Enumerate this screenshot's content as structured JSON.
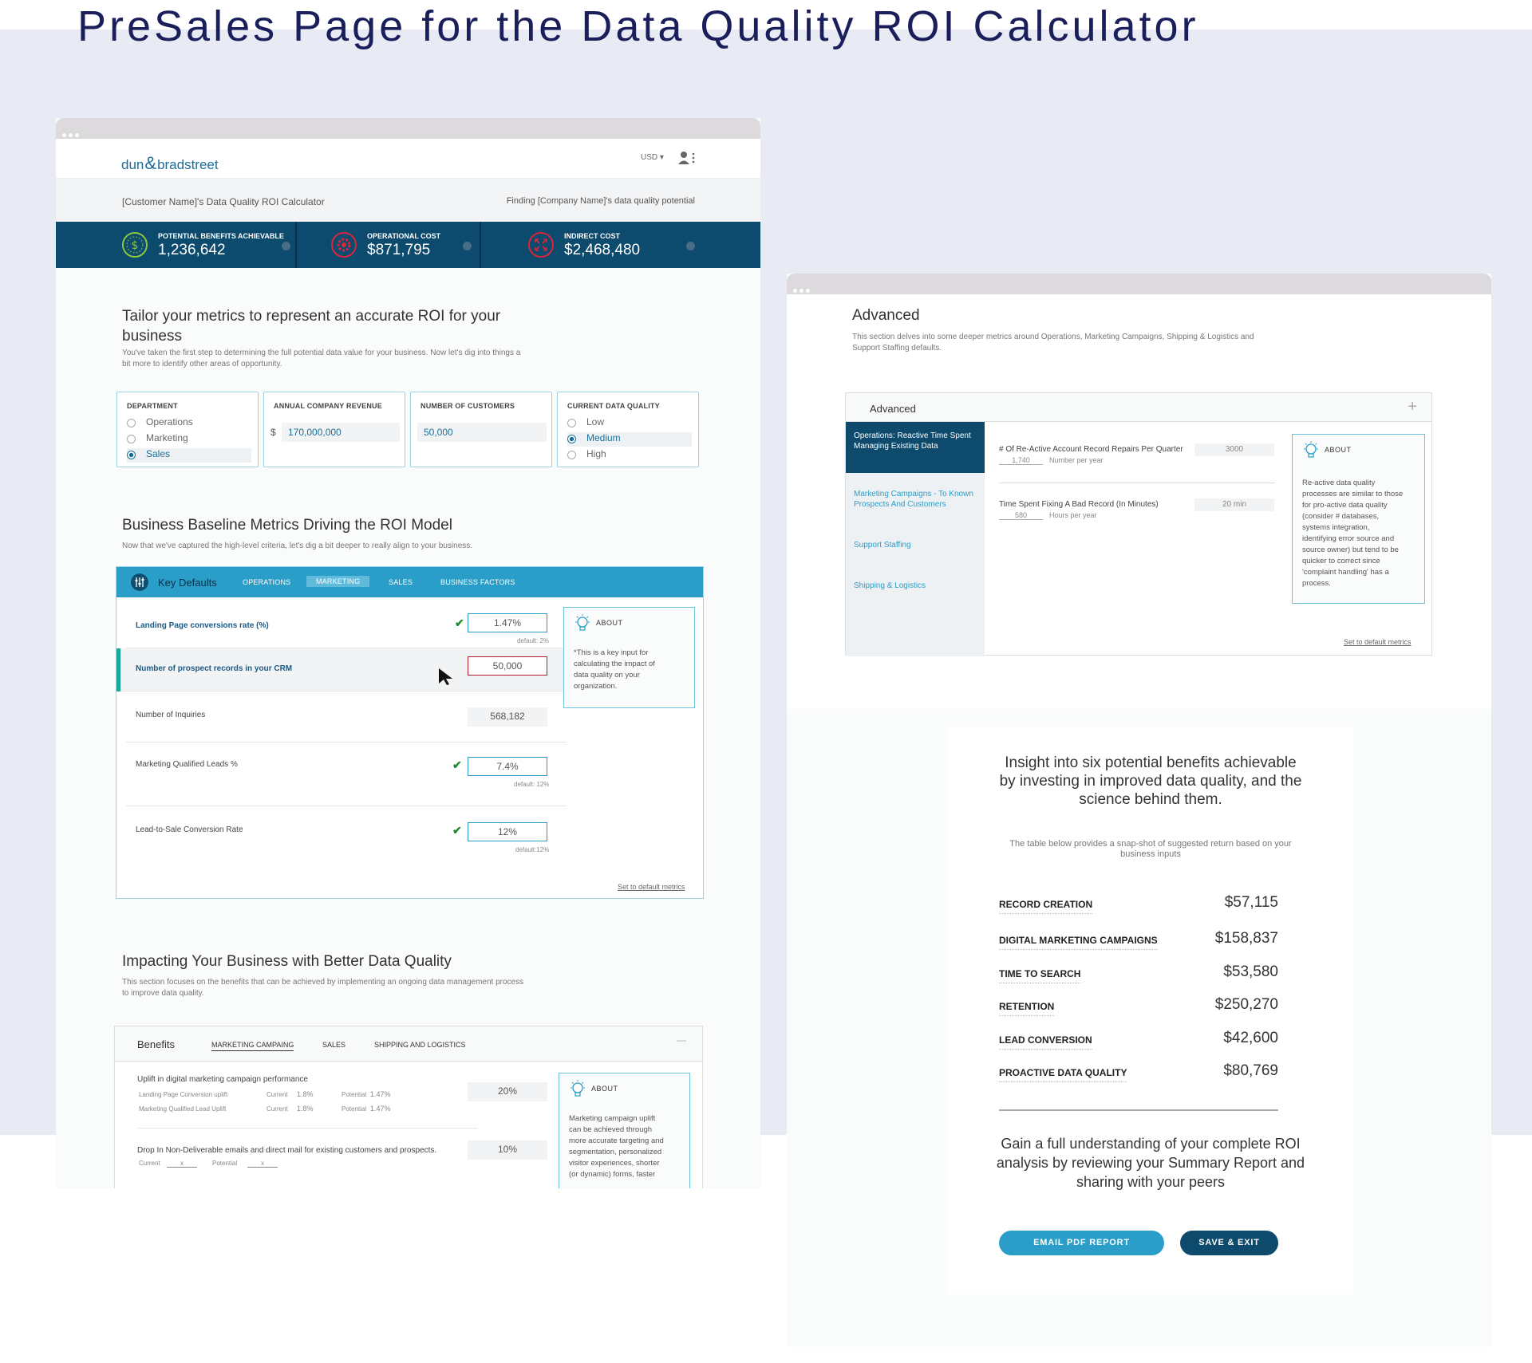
{
  "headline": "PreSales Page for the Data Quality ROI Calculator",
  "calculator": {
    "logo": {
      "left": "dun",
      "amp": "&",
      "right": "bradstreet"
    },
    "currency": "USD ▾",
    "subheader_left": "[Customer Name]'s Data Quality ROI Calculator",
    "subheader_right": "Finding [Company Name]'s data quality potential",
    "kpis": [
      {
        "label": "POTENTIAL BENEFITS ACHIEVABLE",
        "value": "1,236,642",
        "color": "#8cc63f",
        "icon": "dollar-icon"
      },
      {
        "label": "OPERATIONAL COST",
        "value": "$871,795",
        "color": "#d9263a",
        "icon": "gear-icon"
      },
      {
        "label": "INDIRECT COST",
        "value": "$2,468,480",
        "color": "#d9263a",
        "icon": "arrows-icon"
      }
    ],
    "tailor": {
      "title_line1": "Tailor your metrics to represent an accurate ROI for your",
      "title_line2": "business",
      "desc_line1": "You've taken the first step to determining the full potential data value for your business. Now let's dig into things a",
      "desc_line2": "bit more to identify other areas of opportunity."
    },
    "department": {
      "label": "DEPARTMENT",
      "options": [
        "Operations",
        "Marketing",
        "Sales"
      ],
      "selected": "Sales"
    },
    "revenue": {
      "label": "ANNUAL COMPANY REVENUE",
      "prefix": "$",
      "value": "170,000,000"
    },
    "customers": {
      "label": "NUMBER OF CUSTOMERS",
      "value": "50,000"
    },
    "quality": {
      "label": "CURRENT DATA QUALITY",
      "options": [
        "Low",
        "Medium",
        "High"
      ],
      "selected": "Medium"
    },
    "baseline": {
      "title": "Business Baseline Metrics Driving the ROI Model",
      "desc": "Now that we've captured the high-level criteria, let's dig a bit deeper to really align to your business.",
      "tab_title": "Key Defaults",
      "tabs": [
        "OPERATIONS",
        "MARKETING",
        "SALES",
        "BUSINESS FACTORS"
      ],
      "rows": [
        {
          "label": "Landing Page conversions rate (%)",
          "value": "1.47%",
          "default": "default: 2%"
        },
        {
          "label": "Number of prospect records in your CRM",
          "value": "50,000",
          "default": ""
        },
        {
          "label": "Number of Inquiries",
          "value": "568,182",
          "default": ""
        },
        {
          "label": "Marketing Qualified Leads %",
          "value": "7.4%",
          "default": "default: 12%"
        },
        {
          "label": "Lead-to-Sale Conversion Rate",
          "value": "12%",
          "default": "default:12%"
        }
      ],
      "about_title": "ABOUT",
      "about_text": [
        "*This is a  key input for",
        "calculating the impact of",
        "data quality on your",
        "organization."
      ],
      "reset_link": "Set to default metrics"
    },
    "impact": {
      "title": "Impacting Your Business with Better Data Quality",
      "desc_line1": "This section focuses on the benefits that can be achieved by implementing an ongoing data management process",
      "desc_line2": "to improve data quality.",
      "tab_title": "Benefits",
      "tabs": [
        "MARKETING CAMPAING",
        "SALES",
        "SHIPPING AND LOGISTICS"
      ],
      "collapse": "—",
      "row1": {
        "title": "Uplift in digital marketing campaign performance",
        "value": "20%",
        "sub": [
          {
            "label": "Landing Page Conversion uplift",
            "current_label": "Current",
            "current": "1.8%",
            "potential_label": "Potential",
            "potential": "1.47%"
          },
          {
            "label": "Marketing Qualified Lead Uplift",
            "current_label": "Current",
            "current": "1.8%",
            "potential_label": "Potential",
            "potential": "1.47%"
          }
        ]
      },
      "row2": {
        "title": "Drop In Non-Deliverable emails and direct mail for existing customers and prospects.",
        "value": "10%",
        "current_label": "Current",
        "current": "x",
        "potential_label": "Potential",
        "potential": "x"
      },
      "about_title": "ABOUT",
      "about_text": [
        "Marketing campaign uplift",
        "can be achieved through",
        "more accurate targeting and",
        "segmentation, personalized",
        "visitor experiences, shorter",
        "(or dynamic) forms, faster"
      ]
    }
  },
  "advanced": {
    "title": "Advanced",
    "desc_line1": "This section delves into some deeper metrics around Operations, Marketing Campaigns, Shipping & Logistics and",
    "desc_line2": "Support Staffing defaults.",
    "panel_title": "Advanced",
    "plus": "+",
    "sidebar": [
      {
        "label": "Operations: Reactive Time Spent Managing Existing Data"
      },
      {
        "label": "Marketing Campaigns - To Known Prospects And Customers"
      },
      {
        "label": "Support Staffing"
      },
      {
        "label": "Shipping & Logistics"
      }
    ],
    "q1": {
      "label": "# Of Re-Active Account Record Repairs Per Quarter",
      "value": "3000",
      "sub_value": "1,740",
      "sub_label": "Number per year"
    },
    "q2": {
      "label": "Time Spent Fixing A Bad Record (In Minutes)",
      "value": "20 min",
      "sub_value": "580",
      "sub_label": "Hours per year"
    },
    "about_title": "ABOUT",
    "about_text": [
      "Re-active data quality",
      "processes are similar to those",
      "for pro-active data quality",
      "(consider # databases,",
      "systems integration,",
      "identifying error source and",
      "source owner) but tend to be",
      "quicker to correct since",
      "'complaint handling' has a",
      "process."
    ],
    "reset_link": "Set to default metrics"
  },
  "summary": {
    "title": "Insight into six potential benefits achievable by investing in improved data quality, and the science behind them.",
    "desc": "The table below provides a snap-shot of suggested return based on your business inputs",
    "rows": [
      {
        "name": "RECORD CREATION",
        "value": "$57,115"
      },
      {
        "name": "DIGITAL MARKETING CAMPAIGNS",
        "value": "$158,837"
      },
      {
        "name": "TIME TO SEARCH",
        "value": "$53,580"
      },
      {
        "name": "RETENTION",
        "value": "$250,270"
      },
      {
        "name": "LEAD CONVERSION",
        "value": "$42,600"
      },
      {
        "name": "PROACTIVE DATA QUALITY",
        "value": "$80,769"
      }
    ],
    "cta": "Gain a full understanding of your complete ROI analysis by reviewing your Summary Report and sharing with your peers",
    "email_button": "EMAIL PDF REPORT",
    "save_button": "SAVE & EXIT"
  }
}
